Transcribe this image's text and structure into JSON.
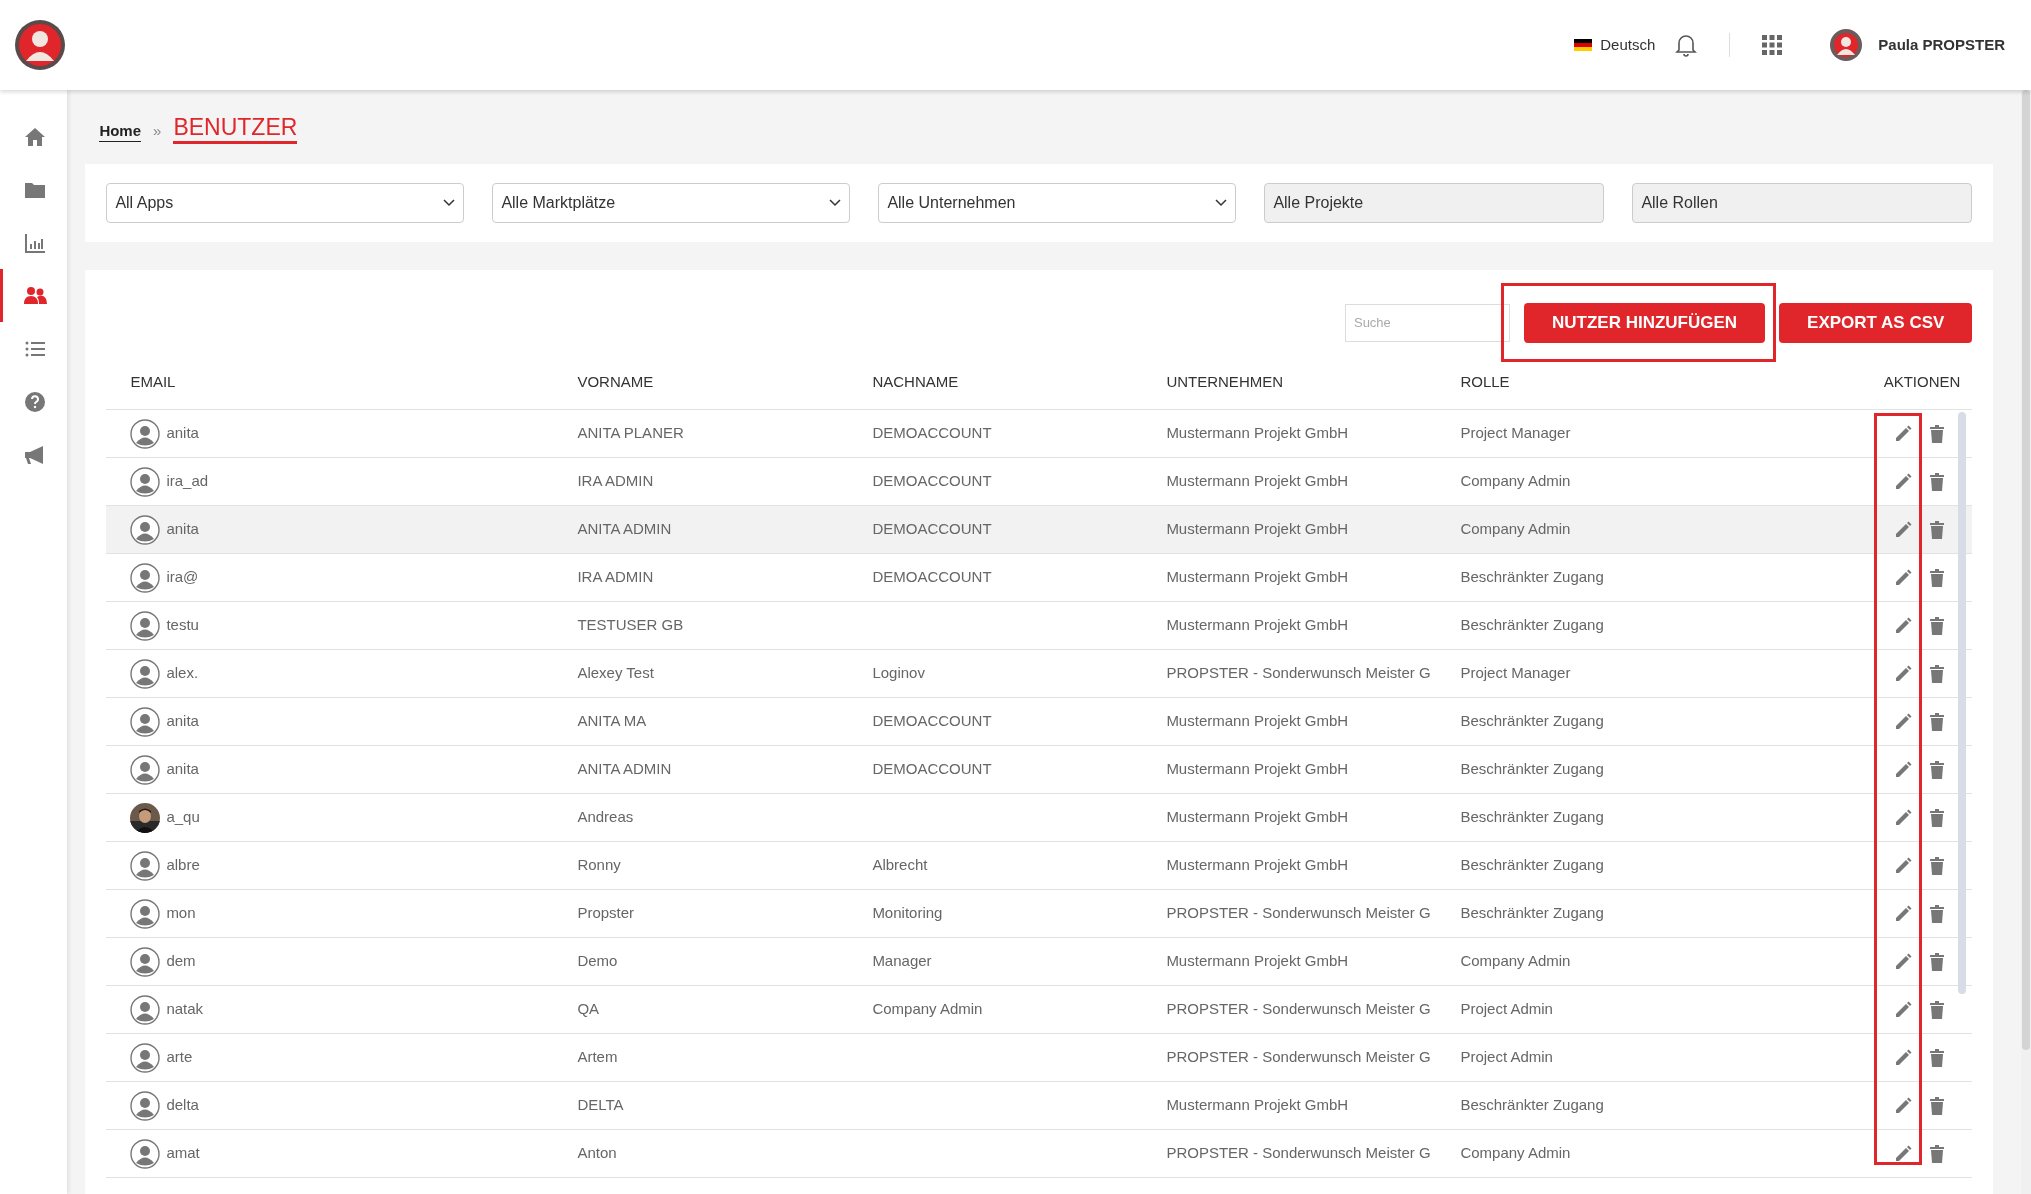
{
  "header": {
    "language": "Deutsch",
    "user_name": "Paula PROPSTER"
  },
  "sidebar": {
    "items": [
      {
        "kind": "home",
        "selected": false
      },
      {
        "kind": "folder",
        "selected": false
      },
      {
        "kind": "chart",
        "selected": false
      },
      {
        "kind": "users",
        "selected": true
      },
      {
        "kind": "list",
        "selected": false
      },
      {
        "kind": "help",
        "selected": false
      },
      {
        "kind": "megaphone",
        "selected": false
      }
    ]
  },
  "breadcrumb": {
    "home": "Home",
    "separator": "»",
    "current": "BENUTZER"
  },
  "filters": [
    {
      "kind": "select",
      "value": "All Apps"
    },
    {
      "kind": "select",
      "value": "Alle Marktplätze"
    },
    {
      "kind": "select",
      "value": "Alle Unternehmen"
    },
    {
      "kind": "input",
      "placeholder": "Alle Projekte"
    },
    {
      "kind": "input",
      "placeholder": "Alle Rollen"
    }
  ],
  "toolbar": {
    "search_placeholder": "Suche",
    "add_button": "NUTZER HINZUFÜGEN",
    "export_button": "EXPORT AS CSV"
  },
  "table": {
    "columns": [
      "EMAIL",
      "VORNAME",
      "NACHNAME",
      "UNTERNEHMEN",
      "ROLLE",
      "AKTIONEN"
    ],
    "rows": [
      {
        "email": "anita",
        "vorname": "ANITA PLANER",
        "nachname": "DEMOACCOUNT",
        "unternehmen": "Mustermann Projekt GmbH",
        "rolle": "Project Manager",
        "kind": "user",
        "hovered": false
      },
      {
        "email": "ira_ad",
        "vorname": "IRA ADMIN",
        "nachname": "DEMOACCOUNT",
        "unternehmen": "Mustermann Projekt GmbH",
        "rolle": "Company Admin",
        "kind": "user",
        "hovered": false
      },
      {
        "email": "anita",
        "vorname": "ANITA ADMIN",
        "nachname": "DEMOACCOUNT",
        "unternehmen": "Mustermann Projekt GmbH",
        "rolle": "Company Admin",
        "kind": "user",
        "hovered": true
      },
      {
        "email": "ira@",
        "vorname": "IRA ADMIN",
        "nachname": "DEMOACCOUNT",
        "unternehmen": "Mustermann Projekt GmbH",
        "rolle": "Beschränkter Zugang",
        "kind": "user",
        "hovered": false
      },
      {
        "email": "testu",
        "vorname": "TESTUSER GB",
        "unternehmen": "Mustermann Projekt GmbH",
        "rolle": "Beschränkter Zugang",
        "kind": "user",
        "hovered": false
      },
      {
        "email": "alex.",
        "vorname": "Alexey Test",
        "nachname": "Loginov",
        "unternehmen": "PROPSTER - Sonderwunsch Meister G",
        "rolle": "Project Manager",
        "kind": "user",
        "hovered": false
      },
      {
        "email": "anita",
        "vorname": "ANITA MA",
        "nachname": "DEMOACCOUNT",
        "unternehmen": "Mustermann Projekt GmbH",
        "rolle": "Beschränkter Zugang",
        "kind": "user",
        "hovered": false
      },
      {
        "email": "anita",
        "vorname": "ANITA ADMIN",
        "nachname": "DEMOACCOUNT",
        "unternehmen": "Mustermann Projekt GmbH",
        "rolle": "Beschränkter Zugang",
        "kind": "user",
        "hovered": false
      },
      {
        "email": "a_qu",
        "vorname": "Andreas",
        "unternehmen": "Mustermann Projekt GmbH",
        "rolle": "Beschränkter Zugang",
        "hovered": false
      },
      {
        "email": "albre",
        "vorname": "Ronny",
        "nachname": "Albrecht",
        "unternehmen": "Mustermann Projekt GmbH",
        "rolle": "Beschränkter Zugang",
        "kind": "user",
        "hovered": false
      },
      {
        "email": "mon",
        "vorname": "Propster",
        "nachname": "Monitoring",
        "unternehmen": "PROPSTER - Sonderwunsch Meister G",
        "rolle": "Beschränkter Zugang",
        "kind": "user",
        "hovered": false
      },
      {
        "email": "dem",
        "vorname": "Demo",
        "nachname": "Manager",
        "unternehmen": "Mustermann Projekt GmbH",
        "rolle": "Company Admin",
        "kind": "user",
        "hovered": false
      },
      {
        "email": "natak",
        "vorname": "QA",
        "nachname": "Company Admin",
        "unternehmen": "PROPSTER - Sonderwunsch Meister G",
        "rolle": "Project Admin",
        "kind": "user",
        "hovered": false
      },
      {
        "email": "arte",
        "vorname": "Artem",
        "unternehmen": "PROPSTER - Sonderwunsch Meister G",
        "rolle": "Project Admin",
        "kind": "user",
        "hovered": false
      },
      {
        "email": "delta",
        "vorname": "DELTA",
        "unternehmen": "Mustermann Projekt GmbH",
        "rolle": "Beschränkter Zugang",
        "kind": "user",
        "hovered": false
      },
      {
        "email": "amat",
        "vorname": "Anton",
        "unternehmen": "PROPSTER - Sonderwunsch Meister G",
        "rolle": "Company Admin",
        "kind": "user",
        "hovered": false
      }
    ]
  }
}
